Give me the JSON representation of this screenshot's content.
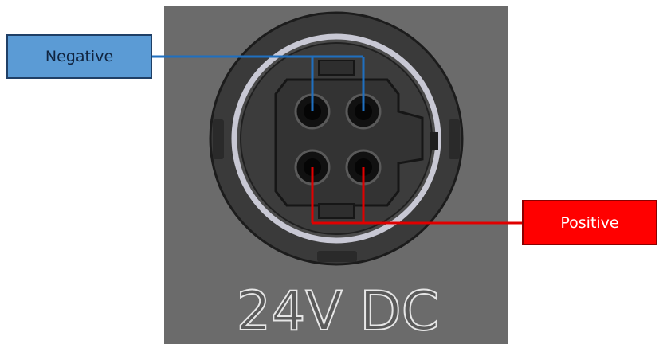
{
  "labels": {
    "negative": "Negative",
    "positive": "Positive",
    "voltage": "24V DC"
  },
  "colors": {
    "panel": "#6b6b6b",
    "negative_wire": "#1f6fbf",
    "positive_wire": "#e00000",
    "negative_box": "#5b9bd5",
    "positive_box": "#ff0000"
  },
  "connector": {
    "pin_count": 4
  }
}
